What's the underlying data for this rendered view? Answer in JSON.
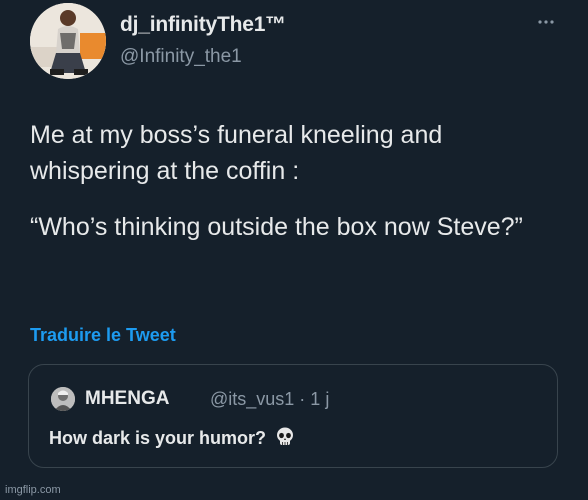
{
  "tweet": {
    "author": {
      "display_name": "dj_infinityThe1™",
      "handle": "@Infinity_the1"
    },
    "text_paragraphs": [
      "Me at my boss’s funeral kneeling and whispering at the coffin :",
      "“Who’s thinking outside the box now Steve?”"
    ],
    "translate_label": "Traduire le Tweet",
    "more_icon": "more-horizontal-icon"
  },
  "quote": {
    "display_name": "MHENGA",
    "meta": "@its_vus1 · 1 j",
    "text": "How dark is your humor?",
    "emoji_icon": "skull-icon"
  },
  "watermark": "imgflip.com",
  "colors": {
    "background": "#15202b",
    "text": "#e7e9ea",
    "secondary_text": "#8b98a5",
    "link": "#1d9bf0",
    "border": "#38444d"
  }
}
